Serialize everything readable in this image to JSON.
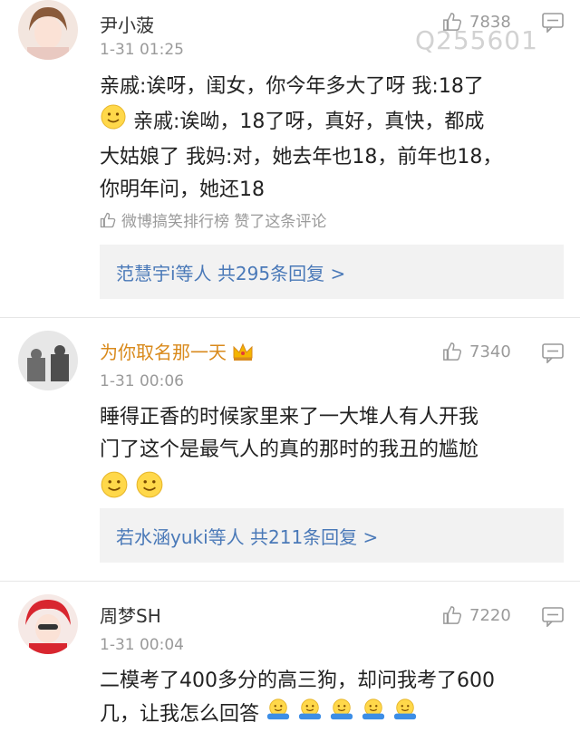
{
  "watermark": "Q255601",
  "comments": [
    {
      "name": "尹小菠",
      "time": "1-31 01:25",
      "likes": "7838",
      "text_line1": "亲戚:诶呀，闺女，你今年多大了呀 我:18了",
      "text_line2": "亲戚:诶呦，18了呀，真好，真快，都成",
      "text_line3": "大姑娘了 我妈:对，她去年也18，前年也18，",
      "text_line4": "你明年问，她还18",
      "liked_by": "微博搞笑排行榜 赞了这条评论",
      "reply_summary": "范慧宇i等人  共295条回复 >"
    },
    {
      "name": "为你取名那一天",
      "time": "1-31 00:06",
      "likes": "7340",
      "text_line1": "睡得正香的时候家里来了一大堆人有人开我",
      "text_line2": "门了这个是最气人的真的那时的我丑的尴尬",
      "reply_summary": "若水涵yuki等人  共211条回复 >"
    },
    {
      "name": "周梦SH",
      "time": "1-31 00:04",
      "likes": "7220",
      "text_line1": "二模考了400多分的高三狗，却问我考了600",
      "text_line2": "几，让我怎么回答"
    }
  ],
  "icons": {
    "like": "thumbs-up-icon",
    "reply": "comment-icon",
    "smile": "smile-emoji",
    "crown": "crown-icon"
  },
  "colors": {
    "reply_link": "#4a79b8",
    "gold_name": "#d98a1c"
  }
}
